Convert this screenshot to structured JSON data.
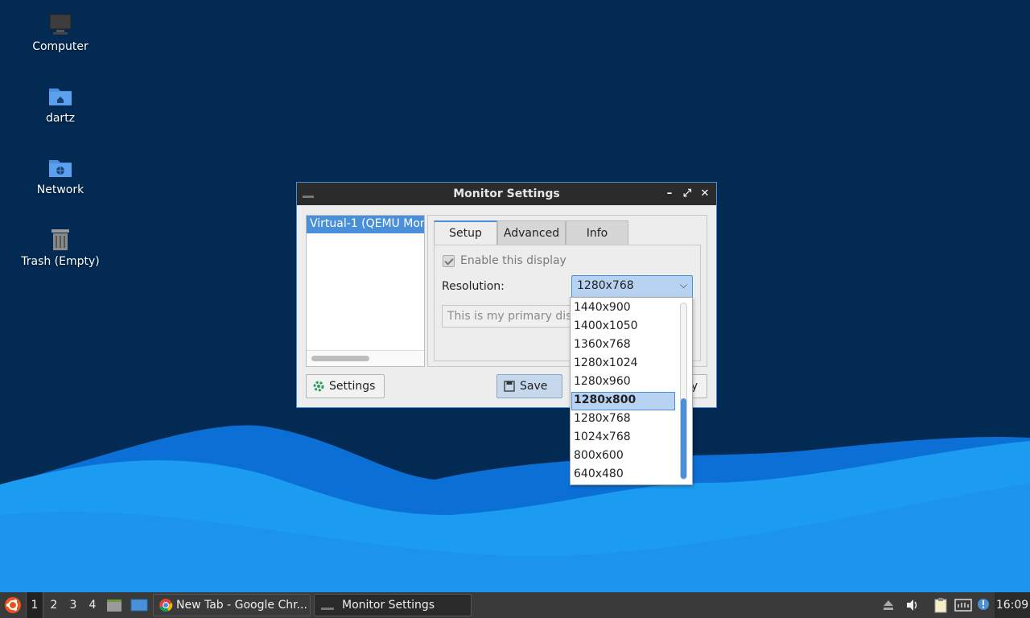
{
  "desktop": {
    "icons": [
      {
        "label": "Computer",
        "icon": "computer-icon"
      },
      {
        "label": "dartz",
        "icon": "home-folder-icon"
      },
      {
        "label": "Network",
        "icon": "network-folder-icon"
      },
      {
        "label": "Trash (Empty)",
        "icon": "trash-icon"
      }
    ]
  },
  "window": {
    "title": "Monitor Settings",
    "controls": {
      "minimize": "–",
      "maximize": "⤢",
      "close": "✕"
    },
    "outputs": {
      "selected": "Virtual-1 (QEMU Mon"
    },
    "tabs": [
      {
        "label": "Setup"
      },
      {
        "label": "Advanced"
      },
      {
        "label": "Info"
      }
    ],
    "setup": {
      "enable_label": "Enable this display",
      "resolution_label": "Resolution:",
      "resolution_value": "1280x768",
      "primary_text": "This is my primary disp"
    },
    "buttons": {
      "settings": "Settings",
      "save": "Save",
      "apply": "y"
    }
  },
  "dropdown": {
    "options": [
      "1440x900",
      "1400x1050",
      "1360x768",
      "1280x1024",
      "1280x960",
      "1280x800",
      "1280x768",
      "1024x768",
      "800x600",
      "640x480"
    ],
    "highlighted": "1280x800"
  },
  "taskbar": {
    "workspaces": [
      "1",
      "2",
      "3",
      "4"
    ],
    "tasks": [
      {
        "label": "New Tab - Google Chr..."
      },
      {
        "label": "Monitor Settings"
      }
    ],
    "clock": "16:09"
  },
  "colors": {
    "accent": "#4a90d9",
    "desktop_bg": "#022a52",
    "wave_light": "#1b9cf0",
    "wave_dark": "#0b6fd6"
  }
}
